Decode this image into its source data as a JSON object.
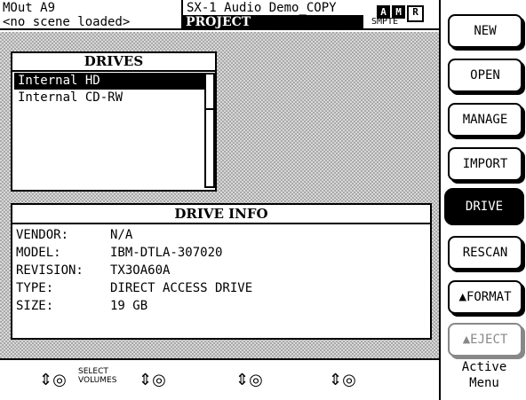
{
  "header": {
    "output": "MOut A9",
    "scene": "<no scene loaded>",
    "title": "SX-1 Audio Demo_COPY",
    "section": "PROJECT",
    "badges": [
      "A",
      "M",
      "R"
    ],
    "timecode_mode": "SMPTE"
  },
  "drives": {
    "title": "DRIVES",
    "items": [
      {
        "label": "Internal HD",
        "selected": true
      },
      {
        "label": "Internal CD-RW",
        "selected": false
      }
    ],
    "scroll_fraction": 0.28
  },
  "drive_info": {
    "title": "DRIVE INFO",
    "rows": [
      {
        "label": "VENDOR:",
        "value": "N/A"
      },
      {
        "label": "MODEL:",
        "value": "IBM-DTLA-307020"
      },
      {
        "label": "REVISION:",
        "value": "TX3OA60A"
      },
      {
        "label": "TYPE:",
        "value": "DIRECT ACCESS DRIVE"
      },
      {
        "label": "SIZE:",
        "value": "19 GB"
      }
    ]
  },
  "menu": {
    "new": "NEW",
    "open": "OPEN",
    "manage": "MANAGE",
    "import": "IMPORT",
    "drive": "DRIVE",
    "rescan": "RESCAN",
    "format": "FORMAT",
    "eject": "EJECT",
    "active_menu_line1": "Active",
    "active_menu_line2": "Menu"
  },
  "bottom": {
    "knob_symbol": "⇕◎",
    "select_volumes_line1": "SELECT",
    "select_volumes_line2": "VOLUMES"
  }
}
